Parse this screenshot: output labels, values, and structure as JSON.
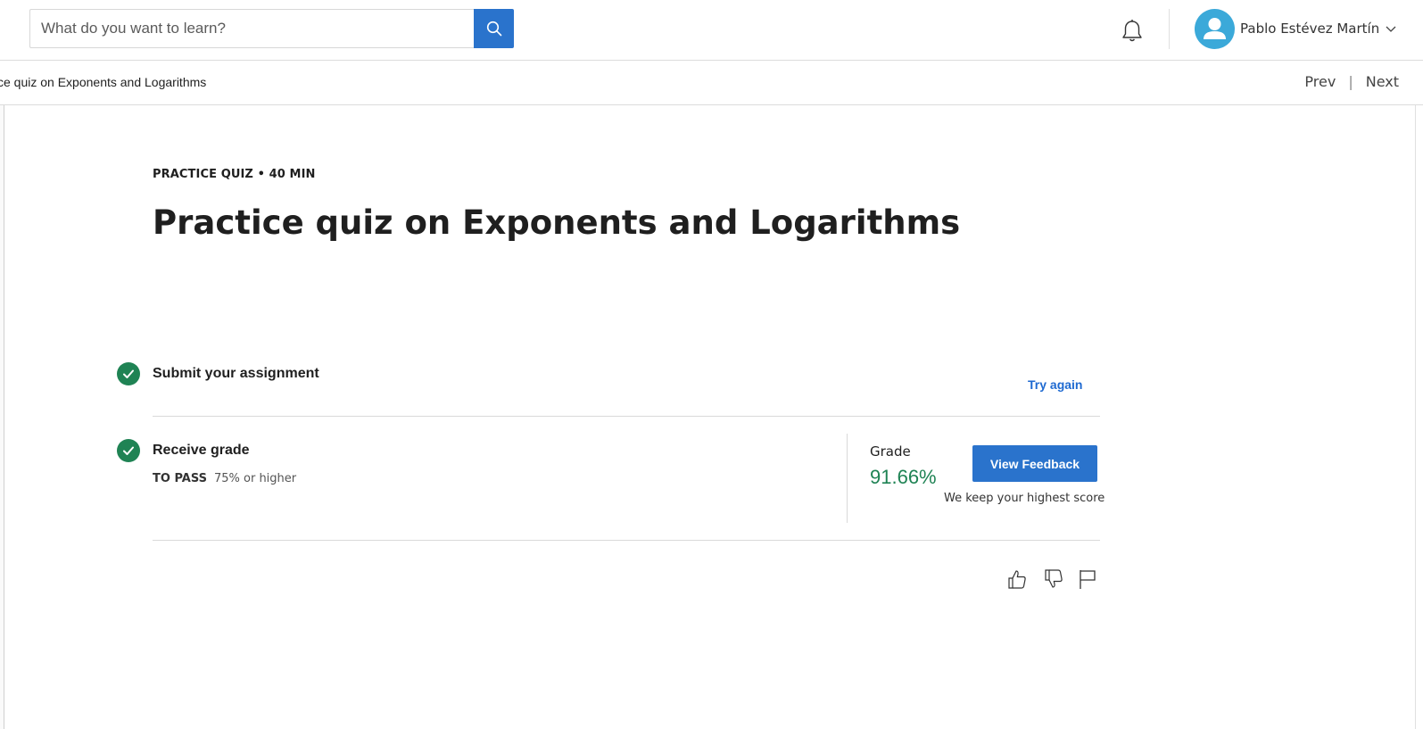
{
  "header": {
    "search": {
      "placeholder": "What do you want to learn?",
      "value": ""
    },
    "user_name": "Pablo Estévez Martín"
  },
  "subbar": {
    "breadcrumb": "ce quiz on Exponents and Logarithms",
    "prev_label": "Prev",
    "separator": "|",
    "next_label": "Next"
  },
  "quiz": {
    "kicker": "PRACTICE QUIZ • 40 MIN",
    "title": "Practice quiz on Exponents and Logarithms"
  },
  "steps": {
    "submit": {
      "title": "Submit your assignment",
      "action_label": "Try again"
    },
    "receive": {
      "title": "Receive grade",
      "to_pass_label": "TO PASS",
      "to_pass_value": "75% or higher"
    }
  },
  "grade": {
    "label": "Grade",
    "value": "91.66%",
    "feedback_button": "View Feedback",
    "note": "We keep your highest score"
  },
  "colors": {
    "accent_blue": "#2a73cc",
    "success_green": "#1f8354",
    "avatar_blue": "#3ba9d9"
  },
  "icons": [
    "search-icon",
    "bell-icon",
    "user-avatar-icon",
    "chevron-down-icon",
    "check-icon",
    "thumbs-up-icon",
    "thumbs-down-icon",
    "flag-icon"
  ]
}
